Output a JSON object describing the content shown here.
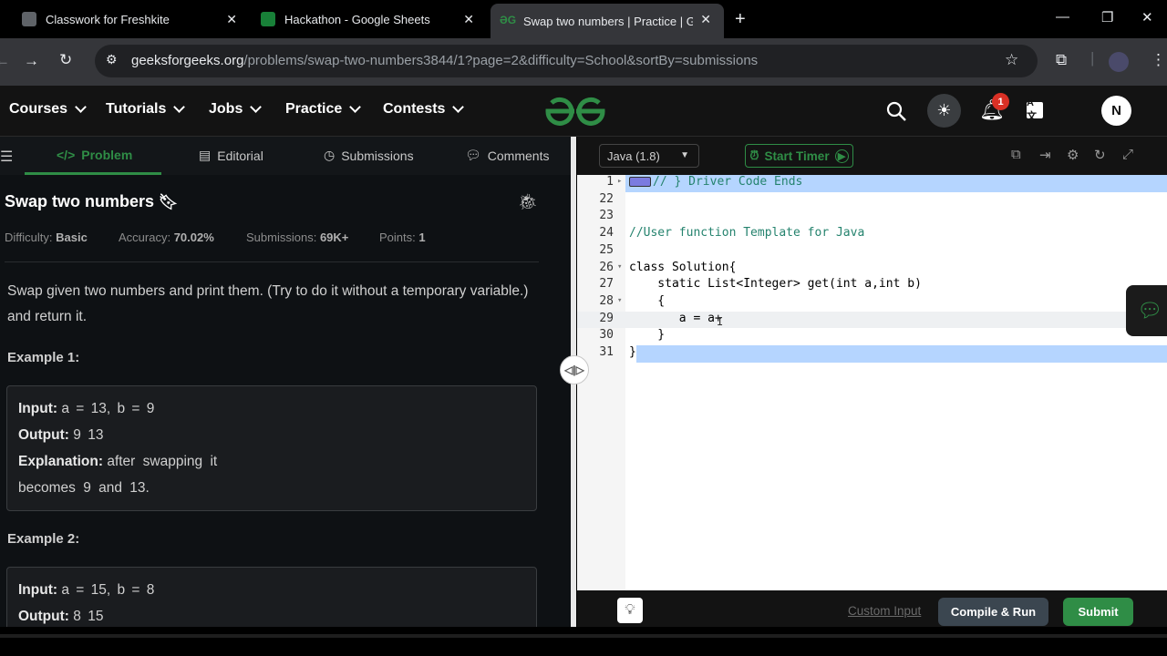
{
  "browser": {
    "tabs": [
      {
        "title": "Classwork for Freshkite",
        "favicon_color": "#5f6368"
      },
      {
        "title": "Hackathon - Google Sheets",
        "favicon_color": "#188038"
      },
      {
        "title": "Swap two numbers | Practice | Gee",
        "favicon_color": "#2f8d46"
      }
    ],
    "new_tab_icon": "plus-icon",
    "address": {
      "host": "geeksforgeeks.org",
      "path": "/problems/swap-two-numbers3844/1?page=2&difficulty=School&sortBy=submissions"
    }
  },
  "nav": {
    "items": [
      "Courses",
      "Tutorials",
      "Jobs",
      "Practice",
      "Contests"
    ],
    "logo_color": "#2f8d46",
    "notification_count": "1",
    "avatar_letter": "N"
  },
  "problem_tabs": {
    "problem": "Problem",
    "editorial": "Editorial",
    "submissions": "Submissions",
    "comments": "Comments"
  },
  "problem": {
    "title": "Swap two numbers",
    "difficulty_label": "Difficulty:",
    "difficulty": "Basic",
    "accuracy_label": "Accuracy:",
    "accuracy": "70.02%",
    "submissions_label": "Submissions:",
    "submissions": "69K+",
    "points_label": "Points:",
    "points": "1",
    "description": "Swap given two numbers and print them. (Try to do it without a temporary variable.) and return it.",
    "example1": {
      "label": "Example 1:",
      "input_label": "Input:",
      "input": "a = 13, b = 9",
      "output_label": "Output:",
      "output": "9 13",
      "explanation_label": "Explanation:",
      "explanation": "after swapping it becomes 9 and 13."
    },
    "example2": {
      "label": "Example 2:",
      "input_label": "Input:",
      "input": "a = 15, b = 8",
      "output_label": "Output:",
      "output": "8 15"
    }
  },
  "editor": {
    "language": "Java (1.8)",
    "start_timer": "Start Timer",
    "lines": [
      {
        "n": "1",
        "text": "// } Driver Code Ends"
      },
      {
        "n": "22",
        "text": ""
      },
      {
        "n": "23",
        "text": ""
      },
      {
        "n": "24",
        "text": "//User function Template for Java"
      },
      {
        "n": "25",
        "text": ""
      },
      {
        "n": "26",
        "text": "class Solution{"
      },
      {
        "n": "27",
        "text": "    static List<Integer> get(int a,int b)"
      },
      {
        "n": "28",
        "text": "    {"
      },
      {
        "n": "29",
        "text": "       a = a+"
      },
      {
        "n": "30",
        "text": "    }"
      },
      {
        "n": "31",
        "text": "}"
      }
    ],
    "custom_input": "Custom Input",
    "compile_run": "Compile & Run",
    "submit": "Submit"
  },
  "colors": {
    "accent": "#2f8d46",
    "selection": "#b5d5ff"
  }
}
